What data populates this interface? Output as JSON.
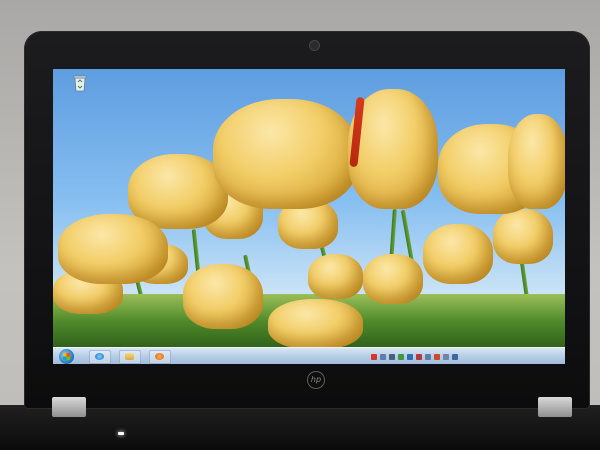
{
  "desktop": {
    "wallpaper": "yellow-tulips",
    "icons": [
      {
        "name": "recycle-bin-icon",
        "label": ""
      }
    ]
  },
  "taskbar": {
    "start_icon": "windows-start-orb-icon",
    "pinned": [
      {
        "name": "internet-explorer-icon"
      },
      {
        "name": "file-explorer-icon"
      },
      {
        "name": "media-player-icon"
      }
    ],
    "tray_icons": [
      "flag-icon",
      "network-icon",
      "volume-icon",
      "battery-icon"
    ],
    "clock_time": "",
    "clock_date": ""
  },
  "device": {
    "brand_logo": "hp",
    "accent": "#1f6fb8"
  }
}
